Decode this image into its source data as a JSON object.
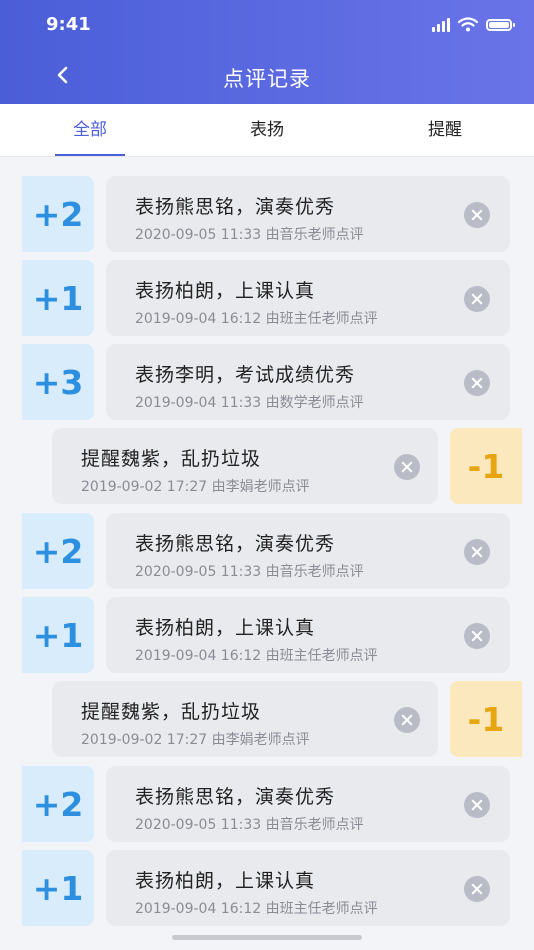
{
  "status": {
    "time": "9:41"
  },
  "header": {
    "title": "点评记录"
  },
  "tabs": [
    {
      "label": "全部",
      "active": true
    },
    {
      "label": "表扬",
      "active": false
    },
    {
      "label": "提醒",
      "active": false
    }
  ],
  "records": [
    {
      "kind": "praise",
      "score": "+2",
      "title": "表扬熊思铭，演奏优秀",
      "meta": "2020-09-05 11:33 由音乐老师点评"
    },
    {
      "kind": "praise",
      "score": "+1",
      "title": "表扬柏朗，上课认真",
      "meta": "2019-09-04  16:12  由班主任老师点评"
    },
    {
      "kind": "praise",
      "score": "+3",
      "title": "表扬李明，考试成绩优秀",
      "meta": "2019-09-04  11:33  由数学老师点评"
    },
    {
      "kind": "remind",
      "score": "-1",
      "title": "提醒魏紫，乱扔垃圾",
      "meta": "2019-09-02 17:27 由李娟老师点评"
    },
    {
      "kind": "praise",
      "score": "+2",
      "title": "表扬熊思铭，演奏优秀",
      "meta": "2020-09-05 11:33 由音乐老师点评"
    },
    {
      "kind": "praise",
      "score": "+1",
      "title": "表扬柏朗，上课认真",
      "meta": "2019-09-04  16:12  由班主任老师点评"
    },
    {
      "kind": "remind",
      "score": "-1",
      "title": "提醒魏紫，乱扔垃圾",
      "meta": "2019-09-02 17:27 由李娟老师点评"
    },
    {
      "kind": "praise",
      "score": "+2",
      "title": "表扬熊思铭，演奏优秀",
      "meta": "2020-09-05 11:33 由音乐老师点评"
    },
    {
      "kind": "praise",
      "score": "+1",
      "title": "表扬柏朗，上课认真",
      "meta": "2019-09-04  16:12  由班主任老师点评"
    }
  ],
  "colors": {
    "header_start": "#4a5ed8",
    "header_end": "#6a74e8",
    "praise": "#2d8fe0",
    "remind": "#e8a512",
    "active_tab": "#4a5ed8"
  },
  "icons": {
    "back": "chevron-left-icon",
    "delete": "close-circle-icon",
    "signal": "signal-icon",
    "wifi": "wifi-icon",
    "battery": "battery-icon"
  }
}
